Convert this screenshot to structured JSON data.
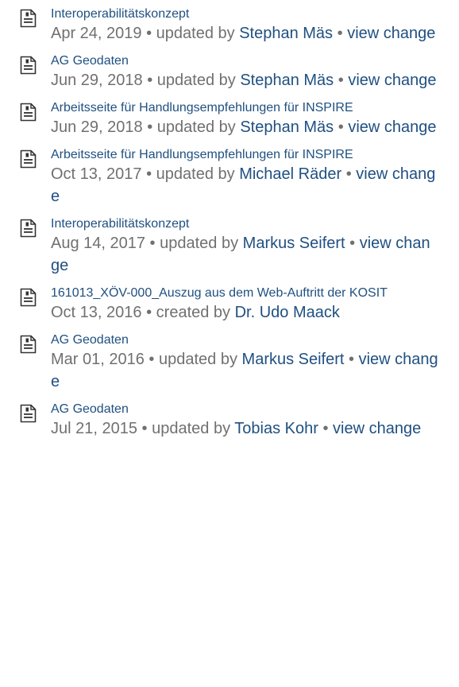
{
  "separator": " • ",
  "entries": [
    {
      "title": "Interoperabilitätskonzept",
      "date": "Apr 24, 2019",
      "action": "updated by",
      "author": "Stephan Mäs",
      "change_label": "view change"
    },
    {
      "title": "AG Geodaten",
      "date": "Jun 29, 2018",
      "action": "updated by",
      "author": "Stephan Mäs",
      "change_label": "view change"
    },
    {
      "title": "Arbeitsseite für Handlungsempfehlungen für INSPIRE",
      "date": "Jun 29, 2018",
      "action": "updated by",
      "author": "Stephan Mäs",
      "change_label": "view change"
    },
    {
      "title": "Arbeitsseite für Handlungsempfehlungen für INSPIRE",
      "date": "Oct 13, 2017",
      "action": "updated by",
      "author": "Michael Räder",
      "change_label": "view change"
    },
    {
      "title": "Interoperabilitätskonzept",
      "date": "Aug 14, 2017",
      "action": "updated by",
      "author": "Markus Seifert",
      "change_label": "view change"
    },
    {
      "title": "161013_XÖV-000_Auszug aus dem Web-Auftritt der KOSIT",
      "date": "Oct 13, 2016",
      "action": "created by",
      "author": "Dr. Udo Maack",
      "change_label": ""
    },
    {
      "title": "AG Geodaten",
      "date": "Mar 01, 2016",
      "action": "updated by",
      "author": "Markus Seifert",
      "change_label": "view change"
    },
    {
      "title": "AG Geodaten",
      "date": "Jul 21, 2015",
      "action": "updated by",
      "author": "Tobias Kohr",
      "change_label": "view change"
    }
  ],
  "icon": "page-document-icon",
  "colors": {
    "link": "#205081",
    "meta": "#707070",
    "icon_stroke": "#333333"
  }
}
